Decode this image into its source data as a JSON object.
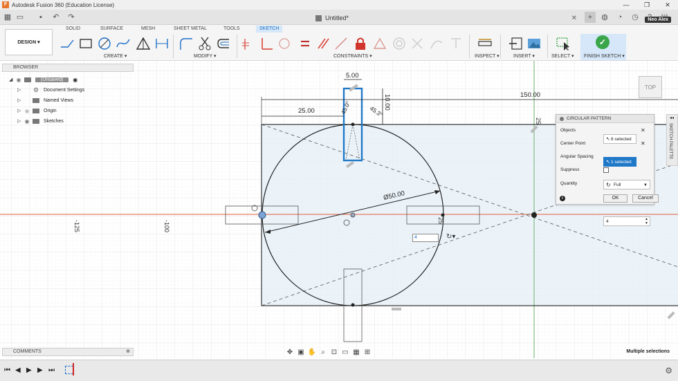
{
  "window": {
    "title": "Autodesk Fusion 360 (Education License)",
    "app_icon": "F",
    "controls": [
      "—",
      "❐",
      "✕"
    ]
  },
  "toolbar": {
    "icons": [
      "grid-menu-icon",
      "file-icon",
      "save-icon",
      "undo-icon",
      "redo-icon"
    ]
  },
  "document": {
    "title": "Untitled*",
    "user": "Neo Alex",
    "user_initials": "NA"
  },
  "ribbon": {
    "workspace": "DESIGN ▾",
    "tabs": [
      "SOLID",
      "SURFACE",
      "MESH",
      "SHEET METAL",
      "TOOLS",
      "SKETCH"
    ],
    "active_tab": "SKETCH",
    "groups": [
      "CREATE ▾",
      "MODIFY ▾",
      "CONSTRAINTS ▾",
      "INSPECT ▾",
      "INSERT ▾",
      "SELECT ▾"
    ],
    "finish": "FINISH SKETCH ▾"
  },
  "browser": {
    "title": "BROWSER",
    "root": "(Unsaved)",
    "items": [
      "Document Settings",
      "Named Views",
      "Origin",
      "Sketches"
    ]
  },
  "dimensions": {
    "width_top": "150.00",
    "offset": "25.00",
    "slot_w": "5.00",
    "slot_h": "10.00",
    "angle_a": "45.0°",
    "angle_b": "45.3°",
    "diameter": "Ø50.00",
    "ruler_a": "-125",
    "ruler_b": "-100",
    "ruler_c": "25",
    "ruler_d": "25"
  },
  "dialog": {
    "title": "CIRCULAR PATTERN",
    "rows": {
      "objects_label": "Objects",
      "objects_value": "6 selected",
      "center_label": "Center Point",
      "center_value": "1 selected",
      "spacing_label": "Angular Spacing",
      "spacing_value": "Full",
      "suppress_label": "Suppress",
      "quantity_label": "Quantity",
      "quantity_value": "4"
    },
    "ok": "OK",
    "cancel": "Cancel"
  },
  "palette_tab": "SKETCH PALETTE",
  "viewcube": "TOP",
  "inline_quantity": "4",
  "comments": "COMMENTS",
  "status": "Multiple selections",
  "colors": {
    "accent": "#1f78c8",
    "axis_red": "#e05a3a",
    "axis_green": "#5aa75a",
    "profile_fill": "#e6f0f8",
    "finish_green": "#3aa64a"
  }
}
